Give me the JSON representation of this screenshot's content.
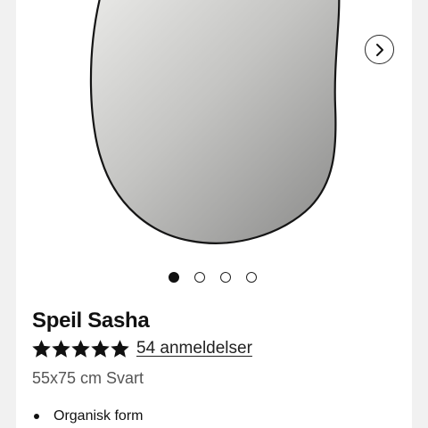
{
  "product": {
    "title": "Speil Sasha",
    "rating": 5,
    "max_rating": 5,
    "reviews_label": "54 anmeldelser",
    "variant": "55x75 cm Svart",
    "features": [
      "Organisk form"
    ]
  },
  "gallery": {
    "image_count": 4,
    "active_index": 0,
    "next_icon": "chevron-right-icon"
  },
  "colors": {
    "star": "#111111",
    "page_background": "#f1f1f1",
    "card_background": "#ffffff"
  }
}
